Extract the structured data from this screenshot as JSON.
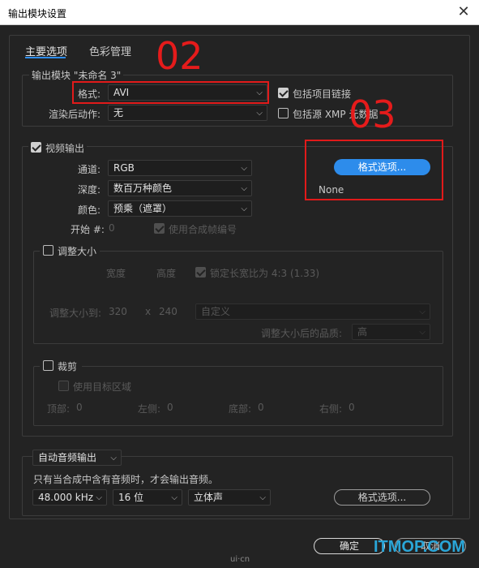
{
  "window": {
    "title": "输出模块设置",
    "close": "✕"
  },
  "tabs": [
    {
      "label": "主要选项"
    },
    {
      "label": "色彩管理"
    }
  ],
  "output_module": {
    "group_label": "输出模块 \"未命名 3\"",
    "format_label": "格式:",
    "format_value": "AVI",
    "post_render_label": "渲染后动作:",
    "post_render_value": "无",
    "include_project_link": "包括项目链接",
    "include_xmp": "包括源 XMP 元数据"
  },
  "video": {
    "enabled_label": "视频输出",
    "channels_label": "通道:",
    "channels_value": "RGB",
    "depth_label": "深度:",
    "depth_value": "数百万种颜色",
    "color_label": "颜色:",
    "color_value": "预乘（遮罩）",
    "start_label": "开始 #:",
    "start_value": "0",
    "use_comp_frame": "使用合成帧编号",
    "format_options_btn": "格式选项...",
    "codec_info": "None"
  },
  "resize": {
    "label": "调整大小",
    "width_col": "宽度",
    "height_col": "高度",
    "lock_aspect": "锁定长宽比为 4:3 (1.33)",
    "resize_to_label": "调整大小到:",
    "width": "320",
    "x": "x",
    "height": "240",
    "preset": "自定义",
    "quality_label": "调整大小后的品质:",
    "quality": "高"
  },
  "crop": {
    "label": "裁剪",
    "use_roi": "使用目标区域",
    "top_label": "顶部:",
    "top": "0",
    "left_label": "左侧:",
    "left": "0",
    "bottom_label": "底部:",
    "bottom": "0",
    "right_label": "右侧:",
    "right": "0"
  },
  "audio": {
    "mode": "自动音频输出",
    "note": "只有当合成中含有音频时，才会输出音频。",
    "sample_rate": "48.000 kHz",
    "bit_depth": "16 位",
    "channels": "立体声",
    "format_options_btn": "格式选项..."
  },
  "footer": {
    "ok": "确定",
    "cancel": "取消"
  },
  "annotations": {
    "step2": "02",
    "step3": "03"
  },
  "watermark": {
    "left": "ui·cn",
    "right": "ITMOP.COM"
  },
  "colors": {
    "accent": "#2d8ceb",
    "annotation_red": "#e11a1a",
    "background": "#232323"
  }
}
